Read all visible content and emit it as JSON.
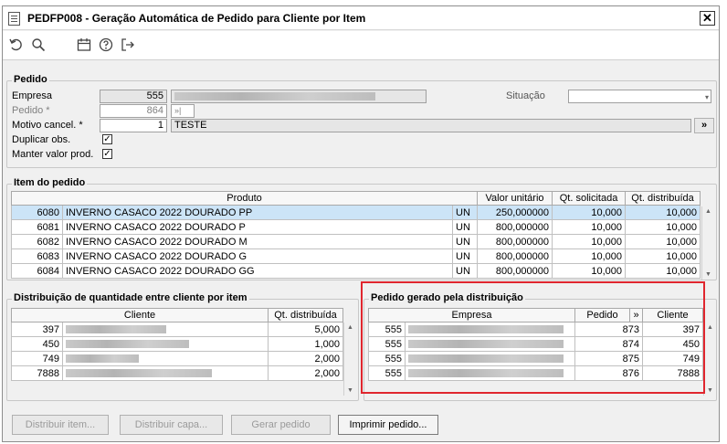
{
  "window": {
    "title": "PEDFP008 - Geração Automática de Pedido para Cliente por Item",
    "close": "✕"
  },
  "toolbar": {
    "icons": [
      "undo-icon",
      "search-icon",
      "calendar-icon",
      "help-icon",
      "exit-icon"
    ]
  },
  "pedido": {
    "group_title": "Pedido",
    "empresa_label": "Empresa",
    "empresa_value": "555",
    "pedido_label": "Pedido *",
    "pedido_value": "864",
    "motivo_label": "Motivo cancel. *",
    "motivo_value": "1",
    "motivo_desc": "TESTE",
    "duplicar_label": "Duplicar obs.",
    "manter_label": "Manter valor prod.",
    "situacao_label": "Situação",
    "more_button": "»"
  },
  "item": {
    "group_title": "Item do pedido",
    "columns": [
      "Produto",
      "Valor unitário",
      "Qt. solicitada",
      "Qt. distribuída"
    ],
    "rows": [
      {
        "code": "6080",
        "desc": "INVERNO CASACO 2022 DOURADO PP",
        "un": "UN",
        "valor": "250,000000",
        "qt_sol": "10,000",
        "qt_dist": "10,000"
      },
      {
        "code": "6081",
        "desc": "INVERNO CASACO 2022 DOURADO P",
        "un": "UN",
        "valor": "800,000000",
        "qt_sol": "10,000",
        "qt_dist": "10,000"
      },
      {
        "code": "6082",
        "desc": "INVERNO CASACO 2022 DOURADO M",
        "un": "UN",
        "valor": "800,000000",
        "qt_sol": "10,000",
        "qt_dist": "10,000"
      },
      {
        "code": "6083",
        "desc": "INVERNO CASACO 2022 DOURADO G",
        "un": "UN",
        "valor": "800,000000",
        "qt_sol": "10,000",
        "qt_dist": "10,000"
      },
      {
        "code": "6084",
        "desc": "INVERNO CASACO 2022 DOURADO GG",
        "un": "UN",
        "valor": "800,000000",
        "qt_sol": "10,000",
        "qt_dist": "10,000"
      }
    ]
  },
  "distribuicao": {
    "group_title": "Distribuição de quantidade entre cliente por item",
    "columns": [
      "Cliente",
      "Qt. distribuída"
    ],
    "rows": [
      {
        "code": "397",
        "qt": "5,000"
      },
      {
        "code": "450",
        "qt": "1,000"
      },
      {
        "code": "749",
        "qt": "2,000"
      },
      {
        "code": "7888",
        "qt": "2,000"
      }
    ]
  },
  "gerado": {
    "group_title": "Pedido gerado pela distribuição",
    "columns": [
      "Empresa",
      "Pedido",
      "»",
      "Cliente"
    ],
    "rows": [
      {
        "empresa": "555",
        "pedido": "873",
        "cliente": "397"
      },
      {
        "empresa": "555",
        "pedido": "874",
        "cliente": "450"
      },
      {
        "empresa": "555",
        "pedido": "875",
        "cliente": "749"
      },
      {
        "empresa": "555",
        "pedido": "876",
        "cliente": "7888"
      }
    ]
  },
  "buttons": {
    "distribuir_item": "Distribuir item...",
    "distribuir_capa": "Distribuir capa...",
    "gerar_pedido": "Gerar pedido",
    "imprimir_pedido": "Imprimir pedido..."
  },
  "colors": {
    "highlight": "#e0262e",
    "selection": "#cce4f7"
  }
}
